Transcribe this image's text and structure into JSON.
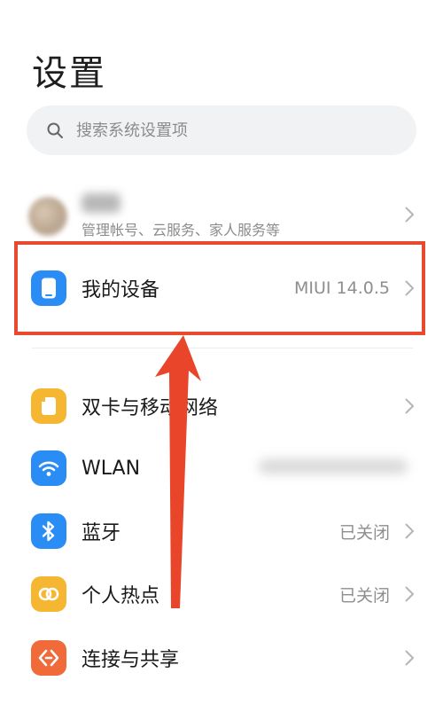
{
  "header": {
    "title": "设置"
  },
  "search": {
    "placeholder": "搜索系统设置项"
  },
  "account": {
    "subtitle": "管理帐号、云服务、家人服务等"
  },
  "items": [
    {
      "label": "我的设备",
      "value": "MIUI 14.0.5",
      "icon": "phone-icon",
      "color": "#2a8df5"
    },
    {
      "label": "双卡与移动网络",
      "value": "",
      "icon": "sim-card-icon",
      "color": "#f5b731"
    },
    {
      "label": "WLAN",
      "value": "",
      "icon": "wifi-icon",
      "color": "#2a8df5"
    },
    {
      "label": "蓝牙",
      "value": "已关闭",
      "icon": "bluetooth-icon",
      "color": "#2a8df5"
    },
    {
      "label": "个人热点",
      "value": "已关闭",
      "icon": "hotspot-icon",
      "color": "#f5b731"
    },
    {
      "label": "连接与共享",
      "value": "",
      "icon": "share-icon",
      "color": "#f06a3a"
    }
  ],
  "annotation": {
    "highlight_color": "#e84a2f",
    "arrow_color": "#e8452a"
  }
}
